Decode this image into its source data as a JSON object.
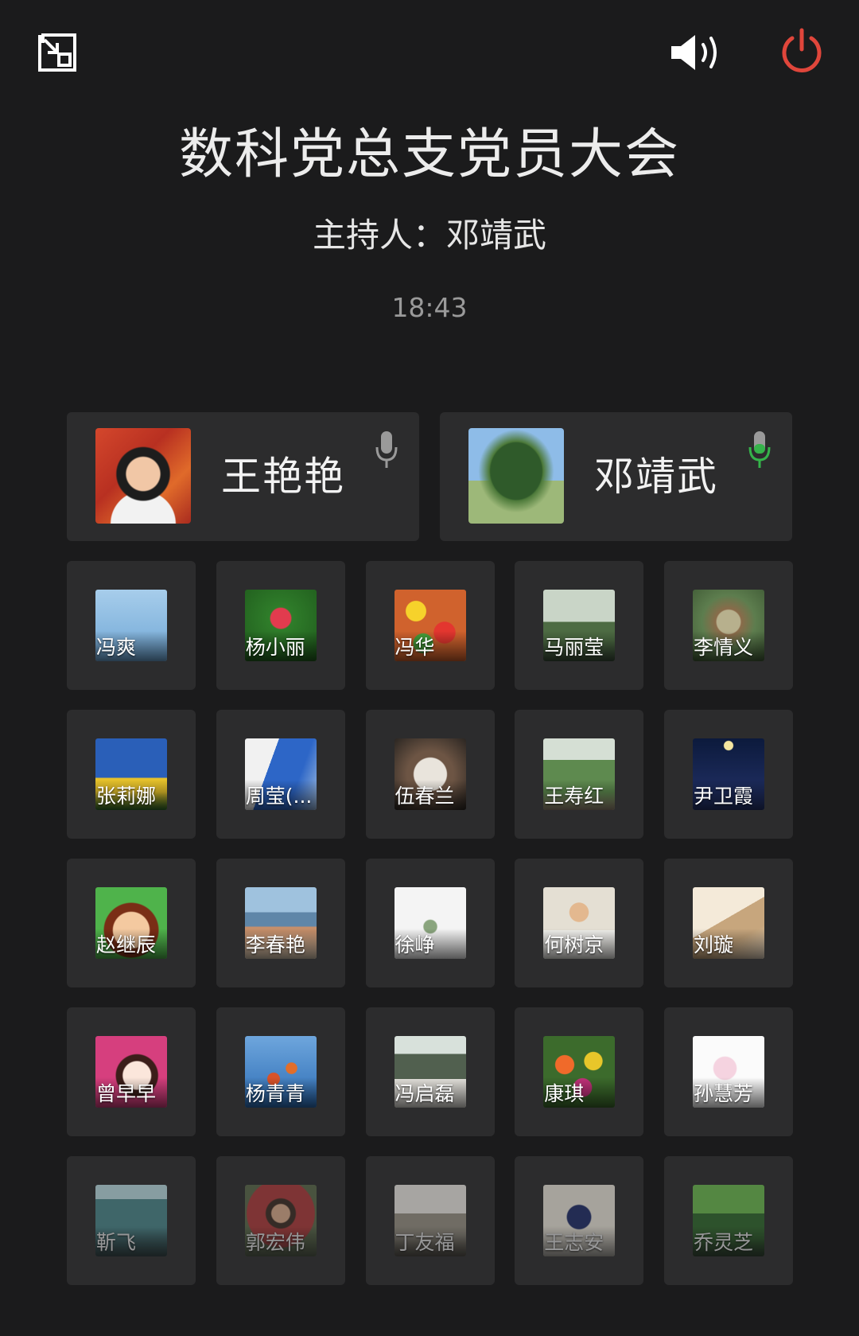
{
  "meeting": {
    "title": "数科党总支党员大会",
    "host_label": "主持人：邓靖武",
    "time": "18:43"
  },
  "icons": {
    "minimize": "minimize-window-icon",
    "speaker": "speaker-volume-icon",
    "power": "power-end-icon",
    "mic": "microphone-icon"
  },
  "colors": {
    "background": "#1b1b1c",
    "card": "#2c2c2d",
    "power": "#e0463b",
    "mic_active": "#35b34a",
    "mic_idle": "#9a9a9a"
  },
  "speakers": [
    {
      "name": "王艳艳",
      "mic_state": "idle"
    },
    {
      "name": "邓靖武",
      "mic_state": "active"
    }
  ],
  "participants": [
    {
      "name": "冯爽",
      "bg": "linear-gradient(#a7cdeb,#6fa7d6)"
    },
    {
      "name": "杨小丽",
      "bg": "radial-gradient(circle at 50% 40%, #e23b4e 0 18%, #2f7d2a 20%, #1f5a1c)"
    },
    {
      "name": "冯华",
      "bg": "radial-gradient(circle at 30% 30%, #f6d22b 0 14%, transparent 15%), radial-gradient(circle at 70% 60%, #e3362f 0 16%, transparent 17%), radial-gradient(circle at 40% 75%, #47a03a 0 14%, transparent 15%), #d0622d"
    },
    {
      "name": "马丽莹",
      "bg": "linear-gradient(#c9d5c7 0 45%, #4d6b43 45% 70%, #3a4d3a)"
    },
    {
      "name": "李情义",
      "bg": "radial-gradient(circle at 50% 45%, #b7b08d 0 22%, #8a6b4a 24%, #5d7d4e 50%, #3f5a35)"
    },
    {
      "name": "张莉娜",
      "bg": "linear-gradient(#2a5fb8 0 55%, #e6c12b 55% 75%, #2d6a2a)"
    },
    {
      "name": "周莹(...",
      "bg": "linear-gradient(110deg, #f1f1f1 0 35%, #2d66c7 35% 70%, #9fbde0)"
    },
    {
      "name": "伍春兰",
      "bg": "radial-gradient(circle at 50% 50%, #e9e4dc 0 32%, #6d5544 34% 46%, #2b2622)"
    },
    {
      "name": "王寿红",
      "bg": "linear-gradient(#d5dfd4 0 30%, #5e8a4f 30% 75%, #9e8d79)"
    },
    {
      "name": "尹卫霞",
      "bg": "radial-gradient(circle at 50% 10%, #f5e6a0 0 6%, transparent 7%), linear-gradient(#0c1a3c, #24336b)"
    },
    {
      "name": "赵继辰",
      "bg": "radial-gradient(circle at 50% 60%, #f4c9a0 0 32%, #7a2e16 34% 48%, #4fb34b 50%)"
    },
    {
      "name": "李春艳",
      "bg": "linear-gradient(#9fc2de 0 35%, #5f86a8 35% 55%, #c58f6b 55% 62%, #d7c6b0)"
    },
    {
      "name": "徐峥",
      "bg": "radial-gradient(circle at 50% 55%, #8aa57e 0 12%, #f4f4f4 14%)"
    },
    {
      "name": "何树京",
      "bg": "radial-gradient(circle at 50% 35%, #e3b88f 0 16%, transparent 17%), linear-gradient(#e4dfd3 0 60%, #f1f0ec 60%)"
    },
    {
      "name": "刘璇",
      "bg": "linear-gradient(150deg, #f4ead9 0 45%, #c7a67d 45% 70%, #e6d7c3)"
    },
    {
      "name": "曾早早",
      "bg": "radial-gradient(circle at 58% 55%, #fbe6db 0 24%, #3c1e1a 26% 36%, #d63f7e 38%)"
    },
    {
      "name": "杨青青",
      "bg": "radial-gradient(circle at 40% 60%, #d8532a 0 10%, transparent 11%), radial-gradient(circle at 65% 45%, #e26e2a 0 9%, transparent 10%), linear-gradient(#6ea6dd, #2c6cb4)"
    },
    {
      "name": "冯启磊",
      "bg": "linear-gradient(#d8e1db 0 25%, #51604f 25% 60%, #e4e2dc 60%)"
    },
    {
      "name": "康琪",
      "bg": "radial-gradient(circle at 30% 40%, #f06a2a 0 14%, transparent 15%), radial-gradient(circle at 70% 35%, #e8c62a 0 13%, transparent 14%), radial-gradient(circle at 55% 72%, #c2317a 0 14%, transparent 15%), #3c6b2c"
    },
    {
      "name": "孙慧芳",
      "bg": "radial-gradient(circle at 45% 45%, #f5d3e0 0 20%, #fbfbfb 22%)"
    },
    {
      "name": "靳飞",
      "bg": "linear-gradient(#bfe3e9 0 20%, #4b8a8f 20% 60%, #2c4b4e)",
      "dim": true
    },
    {
      "name": "郭宏伟",
      "bg": "radial-gradient(circle at 50% 40%, #e0b08e 0 16%, #3c2b22 18% 26%, #b13a3a 28% 60%, #5b6b4b 62%)",
      "dim": true
    },
    {
      "name": "丁友福",
      "bg": "linear-gradient(#f3f0ea 0 40%, #9a9487 40% 70%, #5a5548)",
      "dim": true
    },
    {
      "name": "王志安",
      "bg": "radial-gradient(circle at 50% 45%, #1f2d6b 0 22%, #f1ece0 24%)",
      "dim": true
    },
    {
      "name": "乔灵芝",
      "bg": "linear-gradient(#6ec04f 0 40%, #2f6a2c 40% 75%, #1f3f1f)",
      "dim": true
    }
  ]
}
